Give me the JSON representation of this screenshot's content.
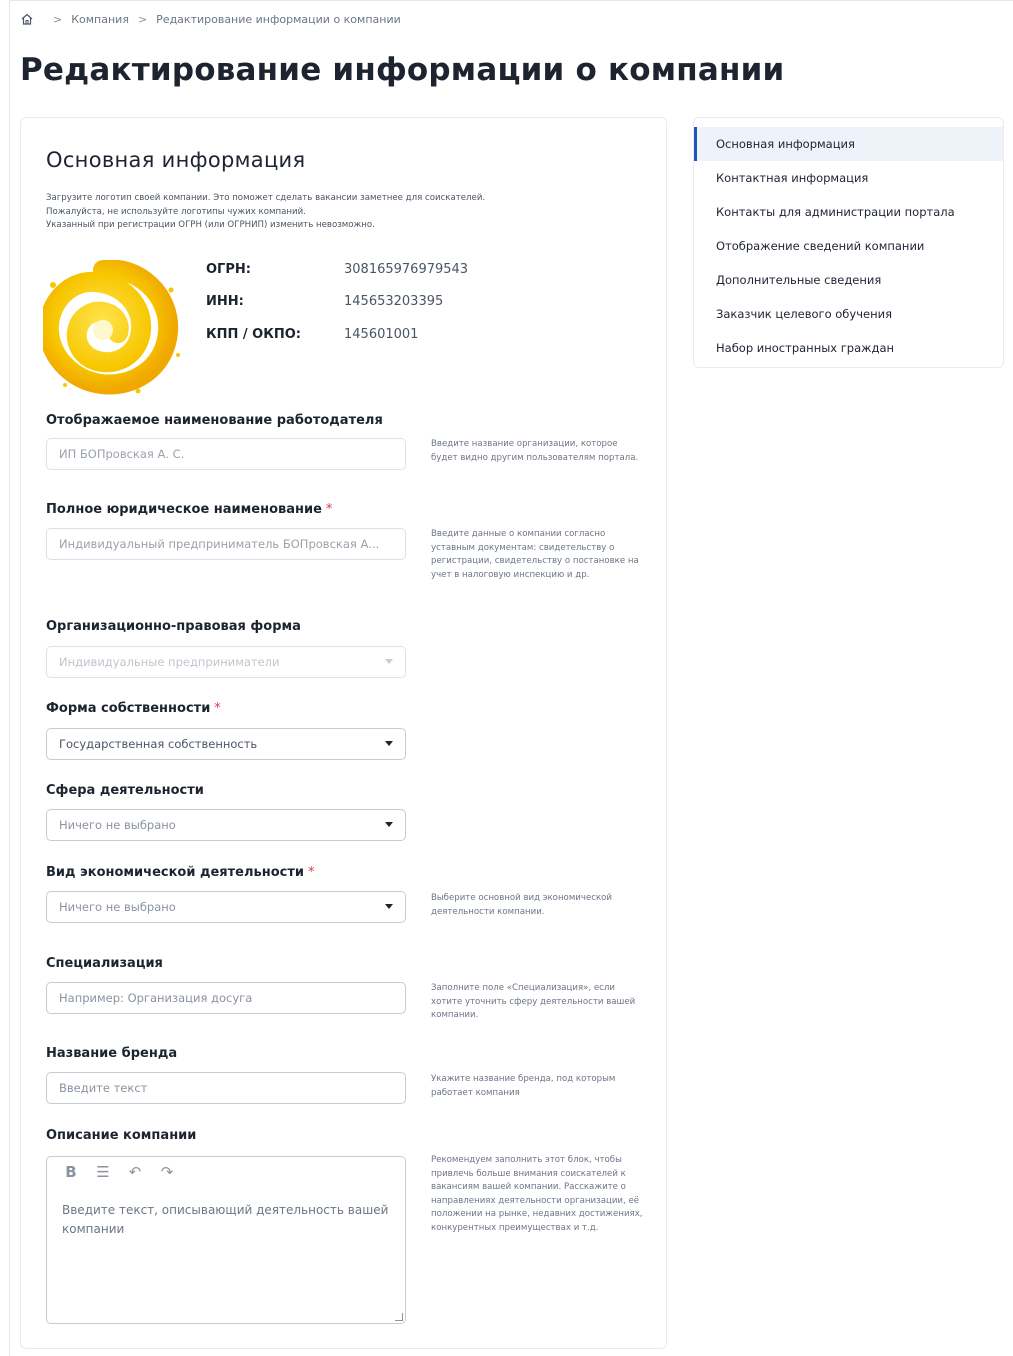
{
  "breadcrumb": {
    "home_icon": "home-icon",
    "separator": ">",
    "items": [
      "Компания",
      "Редактирование информации о компании"
    ]
  },
  "page_title": "Редактирование информации о компании",
  "main": {
    "section_title": "Основная информация",
    "intro_lines": [
      "Загрузите логотип своей компании. Это поможет сделать вакансии заметнее для соискателей.",
      "Пожалуйста, не используйте логотипы чужих компаний.",
      "Указанный при регистрации ОГРН (или ОГРНИП) изменить невозможно."
    ],
    "requisites": [
      {
        "label": "ОГРН:",
        "value": "308165976979543"
      },
      {
        "label": "ИНН:",
        "value": "145653203395"
      },
      {
        "label": "КПП / ОКПО:",
        "value": "145601001"
      }
    ],
    "required_mark": "*",
    "fields": {
      "display_name": {
        "label": "Отображаемое наименование работодателя",
        "value": "ИП БОПровская А. С.",
        "hint": "Введите название организации, которое будет видно другим пользователям портала."
      },
      "legal_name": {
        "label": "Полное юридическое наименование",
        "value": "Индивидуальный предприниматель БОПровская А...",
        "hint": "Введите данные о компании согласно уставным документам: свидетельству о регистрации, свидетельству о постановке на учет в налоговую инспекцию и др."
      },
      "org_form": {
        "label": "Организационно-правовая форма",
        "value": "Индивидуальные предприниматели"
      },
      "ownership": {
        "label": "Форма собственности",
        "value": "Государственная собственность"
      },
      "activity_sphere": {
        "label": "Сфера деятельности",
        "value": "Ничего не выбрано"
      },
      "economic_activity": {
        "label": "Вид экономической деятельности",
        "value": "Ничего не выбрано",
        "hint": "Выберите основной вид экономической деятельности компании."
      },
      "specialization": {
        "label": "Специализация",
        "placeholder": "Например: Организация досуга",
        "hint": "Заполните поле «Специализация», если хотите уточнить сферу деятельности вашей компании."
      },
      "brand": {
        "label": "Название бренда",
        "placeholder": "Введите текст",
        "hint": "Укажите название бренда, под которым работает компания"
      },
      "description": {
        "label": "Описание компании",
        "placeholder": "Введите текст, описывающий деятельность вашей компании",
        "hint": "Рекомендуем заполнить этот блок, чтобы привлечь больше внимания соискателей к вакансиям вашей компании. Расскажите о направлениях деятельности организации, её положении на рынке, недавних достижениях, конкурентных преимуществах и т.д."
      }
    },
    "editor_toolbar": [
      {
        "icon": "bold-icon",
        "glyph": "B"
      },
      {
        "icon": "list-icon",
        "glyph": "☰"
      },
      {
        "icon": "undo-icon",
        "glyph": "↶"
      },
      {
        "icon": "redo-icon",
        "glyph": "↷"
      }
    ]
  },
  "side_nav": {
    "items": [
      "Основная информация",
      "Контактная информация",
      "Контакты для администрации портала",
      "Отображение сведений компании",
      "Дополнительные сведения",
      "Заказчик целевого обучения",
      "Набор иностранных граждан"
    ],
    "active_index": 0
  },
  "colors": {
    "accent": "#1e57b5",
    "required": "#e0364a",
    "logo_yellow": "#f5c400"
  }
}
